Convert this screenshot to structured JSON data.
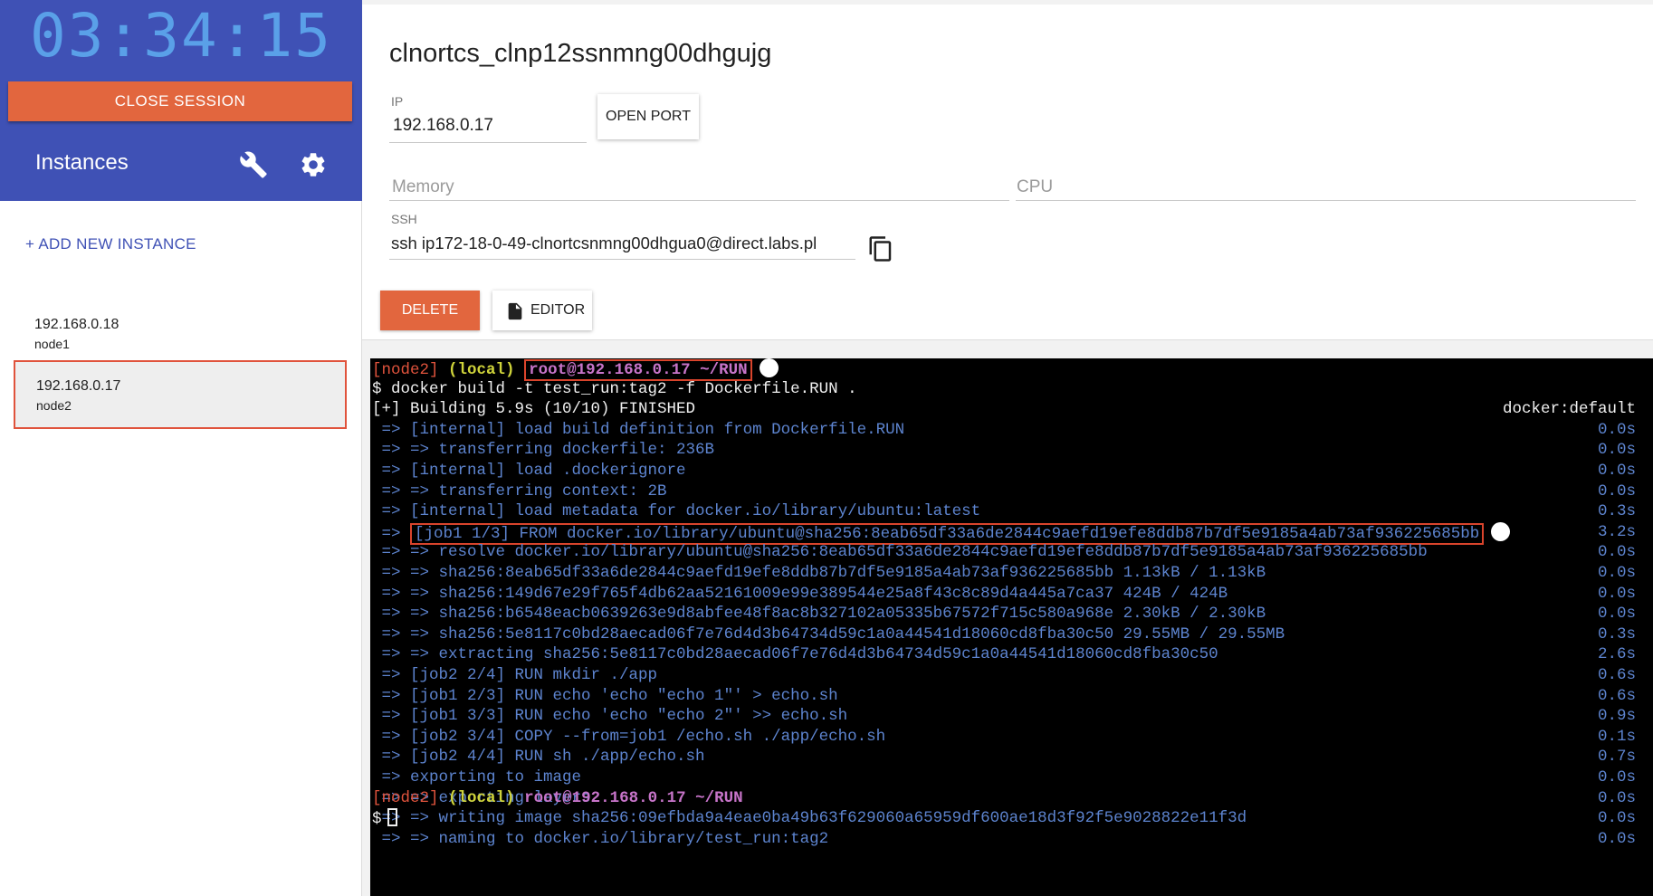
{
  "session": {
    "timer": "03:34:15",
    "close_label": "CLOSE SESSION",
    "instances_title": "Instances",
    "add_instance_label": "+ ADD NEW INSTANCE",
    "instances": [
      {
        "ip": "192.168.0.18",
        "name": "node1"
      },
      {
        "ip": "192.168.0.17",
        "name": "node2"
      }
    ]
  },
  "instance": {
    "title": "clnortcs_clnp12ssnmng00dhgujg",
    "ip_label": "IP",
    "ip_value": "192.168.0.17",
    "open_port_label": "OPEN PORT",
    "memory_placeholder": "Memory",
    "cpu_placeholder": "CPU",
    "ssh_label": "SSH",
    "ssh_value": "ssh ip172-18-0-49-clnortcsnmng00dhgua0@direct.labs.pl",
    "delete_label": "DELETE",
    "editor_label": "EDITOR"
  },
  "terminal": {
    "prompt_node": "[node2]",
    "prompt_local": "(local)",
    "prompt_path": "root@192.168.0.17 ~/RUN",
    "command": "$ docker build -t test_run:tag2 -f Dockerfile.RUN .",
    "building": "[+] Building 5.9s (10/10) FINISHED",
    "builder": "docker:default",
    "steps": [
      {
        "text": " => [internal] load build definition from Dockerfile.RUN",
        "time": "0.0s"
      },
      {
        "text": " => => transferring dockerfile: 236B",
        "time": "0.0s"
      },
      {
        "text": " => [internal] load .dockerignore",
        "time": "0.0s"
      },
      {
        "text": " => => transferring context: 2B",
        "time": "0.0s"
      },
      {
        "text": " => [internal] load metadata for docker.io/library/ubuntu:latest",
        "time": "0.3s"
      },
      {
        "prefix": " => ",
        "text": "[job1 1/3] FROM docker.io/library/ubuntu@sha256:8eab65df33a6de2844c9aefd19efe8ddb87b7df5e9185a4ab73af936225685bb",
        "time": "3.2s"
      },
      {
        "text": " => => resolve docker.io/library/ubuntu@sha256:8eab65df33a6de2844c9aefd19efe8ddb87b7df5e9185a4ab73af936225685bb",
        "time": "0.0s"
      },
      {
        "text": " => => sha256:8eab65df33a6de2844c9aefd19efe8ddb87b7df5e9185a4ab73af936225685bb 1.13kB / 1.13kB",
        "time": "0.0s"
      },
      {
        "text": " => => sha256:149d67e29f765f4db62aa52161009e99e389544e25a8f43c8c89d4a445a7ca37 424B / 424B",
        "time": "0.0s"
      },
      {
        "text": " => => sha256:b6548eacb0639263e9d8abfee48f8ac8b327102a05335b67572f715c580a968e 2.30kB / 2.30kB",
        "time": "0.0s"
      },
      {
        "text": " => => sha256:5e8117c0bd28aecad06f7e76d4d3b64734d59c1a0a44541d18060cd8fba30c50 29.55MB / 29.55MB",
        "time": "0.3s"
      },
      {
        "text": " => => extracting sha256:5e8117c0bd28aecad06f7e76d4d3b64734d59c1a0a44541d18060cd8fba30c50",
        "time": "2.6s"
      },
      {
        "text": " => [job2 2/4] RUN mkdir ./app",
        "time": "0.6s"
      },
      {
        "text": " => [job1 2/3] RUN echo 'echo \"echo 1\"' > echo.sh",
        "time": "0.6s"
      },
      {
        "text": " => [job1 3/3] RUN echo 'echo \"echo 2\"' >> echo.sh",
        "time": "0.9s"
      },
      {
        "text": " => [job2 3/4] COPY --from=job1 /echo.sh ./app/echo.sh",
        "time": "0.1s"
      },
      {
        "text": " => [job2 4/4] RUN sh ./app/echo.sh",
        "time": "0.7s"
      },
      {
        "text": " => exporting to image",
        "time": "0.0s"
      },
      {
        "text": " => => exporting layers",
        "time": "0.0s"
      },
      {
        "text": " => => writing image sha256:09efbda9a4eae0ba49b63f629060a65959df600ae18d3f92f5e9028822e11f3d",
        "time": "0.0s"
      },
      {
        "text": " => => naming to docker.io/library/test_run:tag2",
        "time": "0.0s"
      }
    ],
    "final_prompt_symbol": "$"
  },
  "colors": {
    "accent": "#3f51b5",
    "danger": "#e2663e",
    "terminal_bg": "#000000",
    "terminal_text": "#5d84cf"
  }
}
